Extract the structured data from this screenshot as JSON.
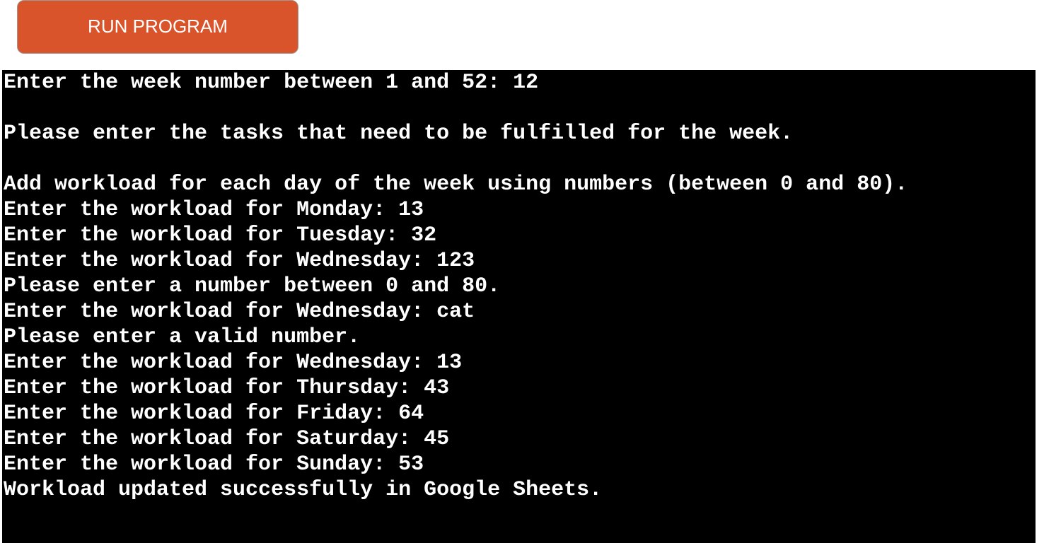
{
  "toolbar": {
    "run_label": "RUN PROGRAM"
  },
  "colors": {
    "run_button": "#d9542a",
    "terminal_bg": "#000000",
    "terminal_fg": "#ffffff"
  },
  "terminal": {
    "lines": [
      "Enter the week number between 1 and 52: 12",
      "",
      "Please enter the tasks that need to be fulfilled for the week.",
      "",
      "Add workload for each day of the week using numbers (between 0 and 80).",
      "Enter the workload for Monday: 13",
      "Enter the workload for Tuesday: 32",
      "Enter the workload for Wednesday: 123",
      "Please enter a number between 0 and 80.",
      "Enter the workload for Wednesday: cat",
      "Please enter a valid number.",
      "Enter the workload for Wednesday: 13",
      "Enter the workload for Thursday: 43",
      "Enter the workload for Friday: 64",
      "Enter the workload for Saturday: 45",
      "Enter the workload for Sunday: 53",
      "Workload updated successfully in Google Sheets."
    ]
  }
}
